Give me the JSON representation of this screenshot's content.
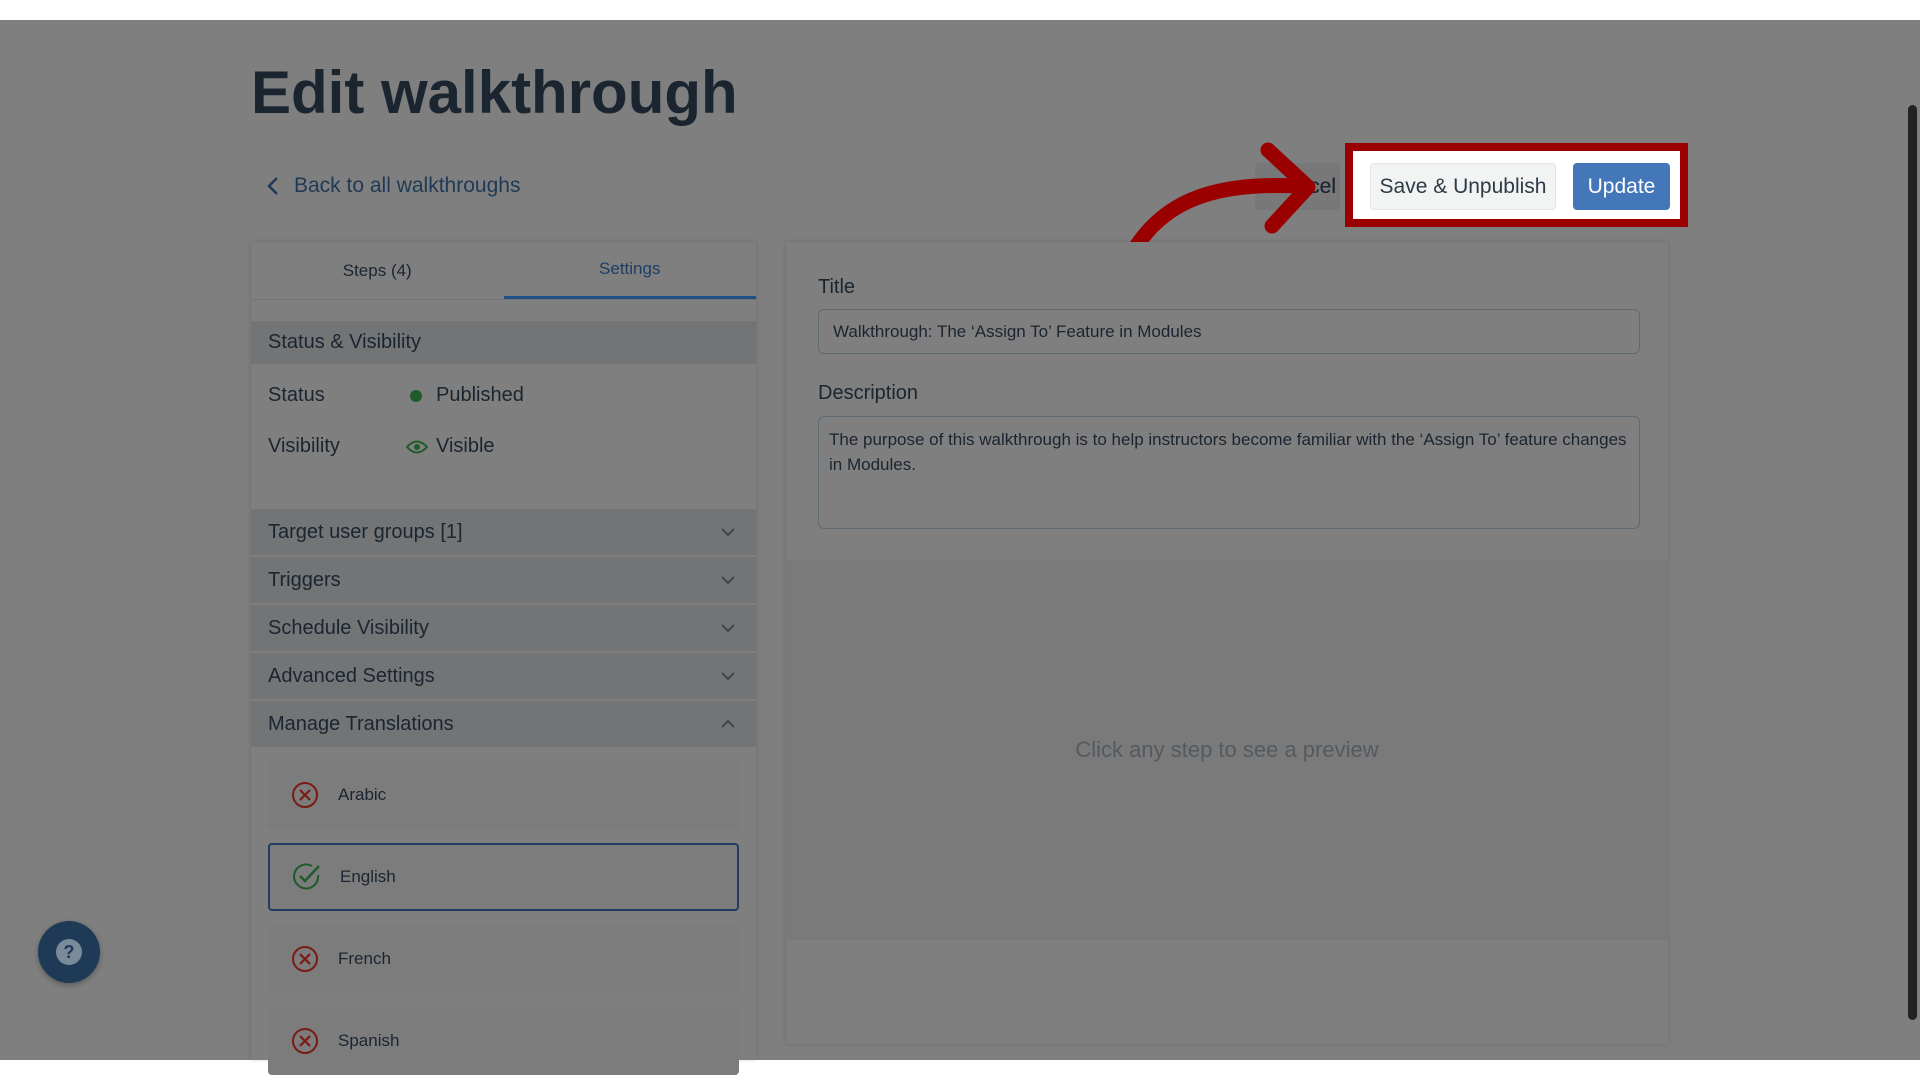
{
  "page": {
    "title": "Edit walkthrough",
    "back_link": "Back to all walkthroughs"
  },
  "actions": {
    "cancel": "Cancel",
    "cancel_visible": "ncel",
    "save_unpublish": "Save & Unpublish",
    "update": "Update"
  },
  "tabs": [
    {
      "label": "Steps (4)"
    },
    {
      "label": "Settings",
      "active": true
    }
  ],
  "status_visibility": {
    "header": "Status & Visibility",
    "status_label": "Status",
    "status_value": "Published",
    "visibility_label": "Visibility",
    "visibility_value": "Visible"
  },
  "sections": [
    {
      "label": "Target user groups [1]",
      "expanded": false
    },
    {
      "label": "Triggers",
      "expanded": false
    },
    {
      "label": "Schedule Visibility",
      "expanded": false
    },
    {
      "label": "Advanced Settings",
      "expanded": false
    },
    {
      "label": "Manage Translations",
      "expanded": true
    }
  ],
  "translations": [
    {
      "label": "Arabic",
      "status": "missing"
    },
    {
      "label": "English",
      "status": "complete",
      "selected": true
    },
    {
      "label": "French",
      "status": "missing"
    },
    {
      "label": "Spanish",
      "status": "missing"
    }
  ],
  "form": {
    "title_label": "Title",
    "title_value": "Walkthrough: The ‘Assign To’ Feature in Modules",
    "description_label": "Description",
    "description_value": "The purpose of this walkthrough is to help instructors become familiar with the ‘Assign To’ feature changes in Modules."
  },
  "preview": {
    "placeholder": "Click any step to see a preview"
  },
  "colors": {
    "accent": "#4477b9",
    "highlight": "#9b0000",
    "published": "#1e5a2a"
  }
}
